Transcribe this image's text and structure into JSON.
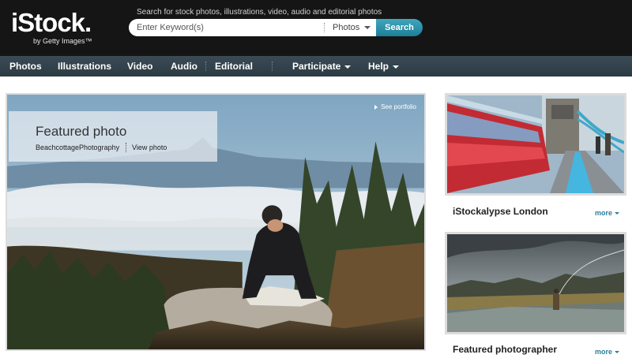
{
  "header": {
    "logo": "iStock.",
    "logo_sub": "by Getty Images™",
    "search_hint": "Search for stock photos, illustrations, video, audio and editorial photos",
    "search_placeholder": "Enter Keyword(s)",
    "search_type": "Photos",
    "search_button": "Search"
  },
  "nav": {
    "items": [
      "Photos",
      "Illustrations",
      "Video",
      "Audio",
      "Editorial",
      "Participate",
      "Help"
    ]
  },
  "featured": {
    "title": "Featured photo",
    "author": "BeachcottagePhotography",
    "view_photo": "View photo",
    "see_portfolio": "See portfolio"
  },
  "cards": [
    {
      "title": "iStockalypse London",
      "more": "more"
    },
    {
      "title": "Featured photographer",
      "more": "more"
    }
  ],
  "colors": {
    "header_bg": "#151515",
    "nav_bg": "#33424b",
    "accent": "#2a8ca6"
  }
}
